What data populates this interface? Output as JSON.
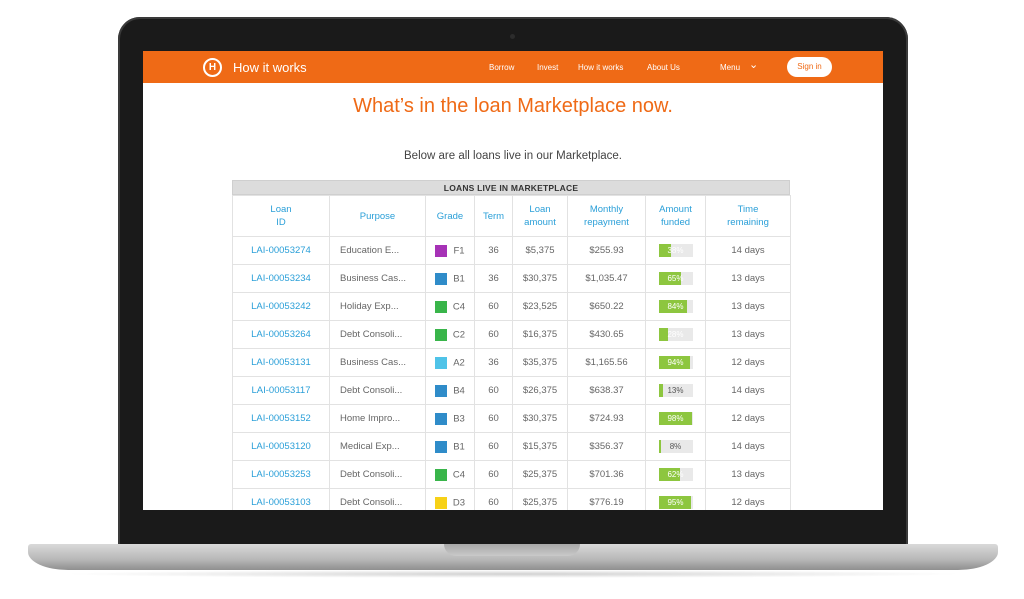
{
  "nav": {
    "logo": "H",
    "brand": "How it works",
    "links": [
      "Borrow",
      "Invest",
      "How it works",
      "About Us"
    ],
    "menu": "Menu",
    "signin": "Sign in"
  },
  "page": {
    "title": "What’s in the loan Marketplace now.",
    "subtitle": "Below are all loans live in our Marketplace."
  },
  "table": {
    "caption": "LOANS LIVE IN MARKETPLACE",
    "headers": [
      "Loan ID",
      "Purpose",
      "Grade",
      "Term",
      "Loan amount",
      "Monthly repayment",
      "Amount funded",
      "Time remaining"
    ],
    "rows": [
      {
        "id": "LAI-00053274",
        "purpose": "Education E...",
        "grade": "F1",
        "grade_color": "#a632b6",
        "term": "36",
        "amount": "$5,375",
        "repayment": "$255.93",
        "funded": "38%",
        "funded_pct": 38,
        "time": "14 days"
      },
      {
        "id": "LAI-00053234",
        "purpose": "Business Cas...",
        "grade": "B1",
        "grade_color": "#2f8cc9",
        "term": "36",
        "amount": "$30,375",
        "repayment": "$1,035.47",
        "funded": "65%",
        "funded_pct": 65,
        "time": "13 days"
      },
      {
        "id": "LAI-00053242",
        "purpose": "Holiday Exp...",
        "grade": "C4",
        "grade_color": "#39b54a",
        "term": "60",
        "amount": "$23,525",
        "repayment": "$650.22",
        "funded": "84%",
        "funded_pct": 84,
        "time": "13 days"
      },
      {
        "id": "LAI-00053264",
        "purpose": "Debt Consoli...",
        "grade": "C2",
        "grade_color": "#39b54a",
        "term": "60",
        "amount": "$16,375",
        "repayment": "$430.65",
        "funded": "28%",
        "funded_pct": 28,
        "time": "13 days"
      },
      {
        "id": "LAI-00053131",
        "purpose": "Business Cas...",
        "grade": "A2",
        "grade_color": "#4fc3e8",
        "term": "36",
        "amount": "$35,375",
        "repayment": "$1,165.56",
        "funded": "94%",
        "funded_pct": 94,
        "time": "12 days"
      },
      {
        "id": "LAI-00053117",
        "purpose": "Debt Consoli...",
        "grade": "B4",
        "grade_color": "#2f8cc9",
        "term": "60",
        "amount": "$26,375",
        "repayment": "$638.37",
        "funded": "13%",
        "funded_pct": 13,
        "time": "14 days"
      },
      {
        "id": "LAI-00053152",
        "purpose": "Home Impro...",
        "grade": "B3",
        "grade_color": "#2f8cc9",
        "term": "60",
        "amount": "$30,375",
        "repayment": "$724.93",
        "funded": "98%",
        "funded_pct": 98,
        "time": "12 days"
      },
      {
        "id": "LAI-00053120",
        "purpose": "Medical Exp...",
        "grade": "B1",
        "grade_color": "#2f8cc9",
        "term": "60",
        "amount": "$15,375",
        "repayment": "$356.37",
        "funded": "8%",
        "funded_pct": 8,
        "time": "14 days"
      },
      {
        "id": "LAI-00053253",
        "purpose": "Debt Consoli...",
        "grade": "C4",
        "grade_color": "#39b54a",
        "term": "60",
        "amount": "$25,375",
        "repayment": "$701.36",
        "funded": "62%",
        "funded_pct": 62,
        "time": "13 days"
      },
      {
        "id": "LAI-00053103",
        "purpose": "Debt Consoli...",
        "grade": "D3",
        "grade_color": "#f7d117",
        "term": "60",
        "amount": "$25,375",
        "repayment": "$776.19",
        "funded": "95%",
        "funded_pct": 95,
        "time": "12 days"
      }
    ]
  },
  "colors": {
    "accent": "#ef6a16",
    "link": "#2a9fd8",
    "funded_bar": "#8dc63f"
  }
}
